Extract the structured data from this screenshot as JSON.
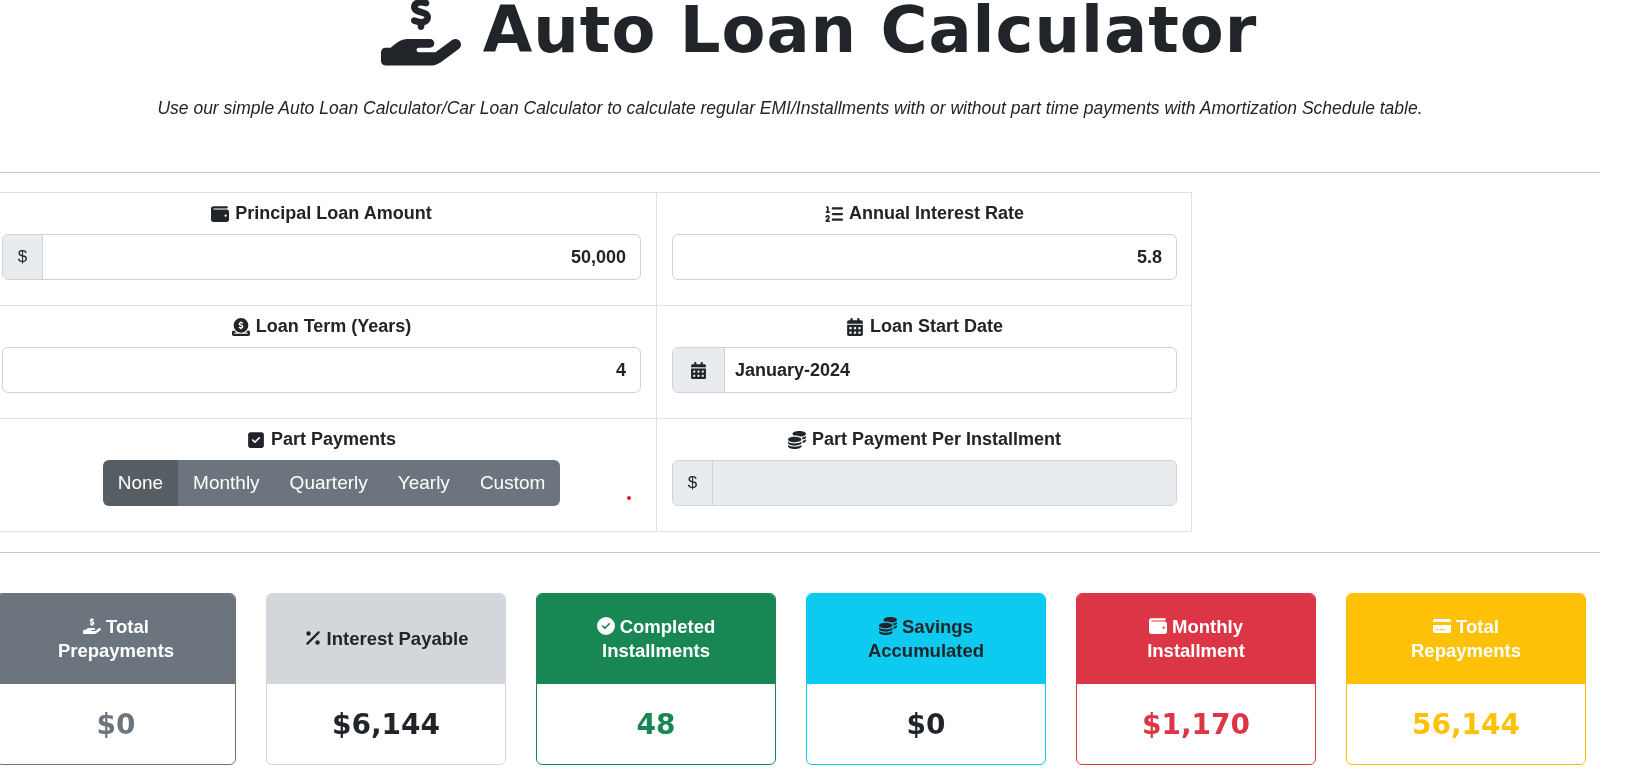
{
  "title": "Auto Loan Calculator",
  "subtitle": "Use our simple Auto Loan Calculator/Car Loan Calculator to calculate regular EMI/Installments with or without part time payments with Amortization Schedule table.",
  "fields": [
    {
      "label": "Principal Loan Amount",
      "kind": "prefixed",
      "prefix": "$",
      "value": "50,000",
      "disabled": false
    },
    {
      "label": "Annual Interest Rate",
      "kind": "plain",
      "value": "5.8",
      "disabled": false
    },
    {
      "label": "Loan Term (Years)",
      "kind": "plain",
      "value": "4",
      "disabled": false
    },
    {
      "label": "Loan Start Date",
      "kind": "date",
      "value": "January-2024",
      "disabled": false
    },
    {
      "label": "Part Payments",
      "kind": "segments",
      "options": [
        {
          "label": "None",
          "selected": true
        },
        {
          "label": "Monthly",
          "selected": false
        },
        {
          "label": "Quarterly",
          "selected": false
        },
        {
          "label": "Yearly",
          "selected": false
        },
        {
          "label": "Custom",
          "selected": false
        }
      ]
    },
    {
      "label": "Part Payment Per Installment",
      "kind": "prefixed",
      "prefix": "$",
      "disabled": true
    }
  ],
  "cards": [
    {
      "title": "Total Prepayments",
      "value": "$0",
      "kind": "secondary"
    },
    {
      "title": "Interest Payable",
      "value": "$6,144",
      "kind": "light"
    },
    {
      "title": "Completed Installments",
      "value": "48",
      "kind": "success"
    },
    {
      "title": "Savings Accumulated",
      "value": "$0",
      "kind": "info"
    },
    {
      "title": "Monthly Installment",
      "value": "$1,170",
      "kind": "danger"
    },
    {
      "title": "Total Repayments",
      "value": "56,144",
      "kind": "warning"
    }
  ]
}
